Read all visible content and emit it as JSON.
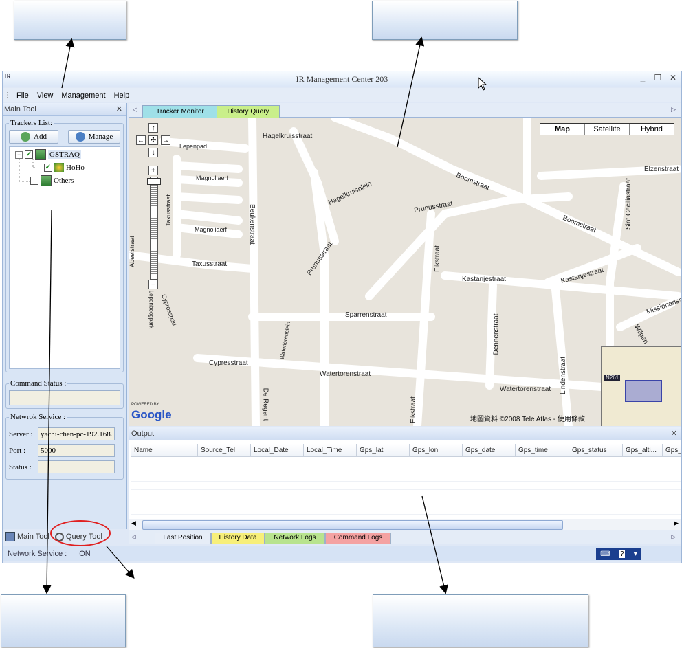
{
  "window": {
    "title": "IR Management Center 203",
    "logo": "IR",
    "min": "_",
    "restore": "❐",
    "close": "✕"
  },
  "menu": [
    "File",
    "View",
    "Management",
    "Help"
  ],
  "left_panel": {
    "title": "Main Tool",
    "trackers_legend": "Trackers List:",
    "add_label": "Add",
    "manage_label": "Manage",
    "tree": [
      {
        "label": "GSTRAQ",
        "checked": true
      },
      {
        "label": "HoHo",
        "checked": true
      },
      {
        "label": "Others",
        "checked": false
      }
    ],
    "command_status_legend": "Command Status :",
    "network_legend": "Netwrok Service :",
    "server_label": "Server :",
    "server_value": "yachi-chen-pc-192.168.",
    "port_label": "Port :",
    "port_value": "5000",
    "status_label": "Status :",
    "status_value": "",
    "tab_main": "Main Tool",
    "tab_query": "Query Tool"
  },
  "doc_tabs": [
    "Tracker Monitor",
    "History Query"
  ],
  "map": {
    "map_types": [
      "Map",
      "Satellite",
      "Hybrid"
    ],
    "streets": [
      "Hagelkruisstraat",
      "Boomstraat",
      "Elzenstraat",
      "Hagelkruisplein",
      "Prunusstraat",
      "Magnoliaerf",
      "Magnoliaerf",
      "Taxusstraat",
      "Beukenstraat",
      "Abeelstraat",
      "Taxusstraat",
      "Prunusstraat",
      "Boomstraat",
      "Sint Ceciliastraat",
      "Eikstraat",
      "Kastanjestraat",
      "Kastanjestraat",
      "Sparrenstraat",
      "Dennenstraat",
      "Missionarisstr",
      "Cypresspad",
      "Cypresstraat",
      "Watertorenstraat",
      "Watertorenstraat",
      "Lindenstraat",
      "Eikstraat",
      "De Regent",
      "Lepenpad",
      "Lepenboogpark",
      "Waterlorenplein",
      "Wilgen"
    ],
    "powered_by": "POWERED BY",
    "google": "Google",
    "copyright": "地圖資料 ©2008 Tele Atlas - 使用條款",
    "overview_label": "N261"
  },
  "output": {
    "title": "Output",
    "columns": [
      "Name",
      "Source_Tel",
      "Local_Date",
      "Local_Time",
      "Gps_lat",
      "Gps_lon",
      "Gps_date",
      "Gps_time",
      "Gps_status",
      "Gps_alti...",
      "Gps_"
    ]
  },
  "output_tabs": [
    "Last Position",
    "History Data",
    "Network Logs",
    "Command Logs"
  ],
  "statusbar": {
    "label": "Network Service :",
    "value": "ON"
  },
  "colors": {
    "tab_tracker": "#9fe0e8",
    "tab_history": "#c9ef8a",
    "otab_last": "#e6edf7",
    "otab_history": "#f7ef7a",
    "otab_network": "#b8e38e",
    "otab_command": "#f4a2a2"
  }
}
